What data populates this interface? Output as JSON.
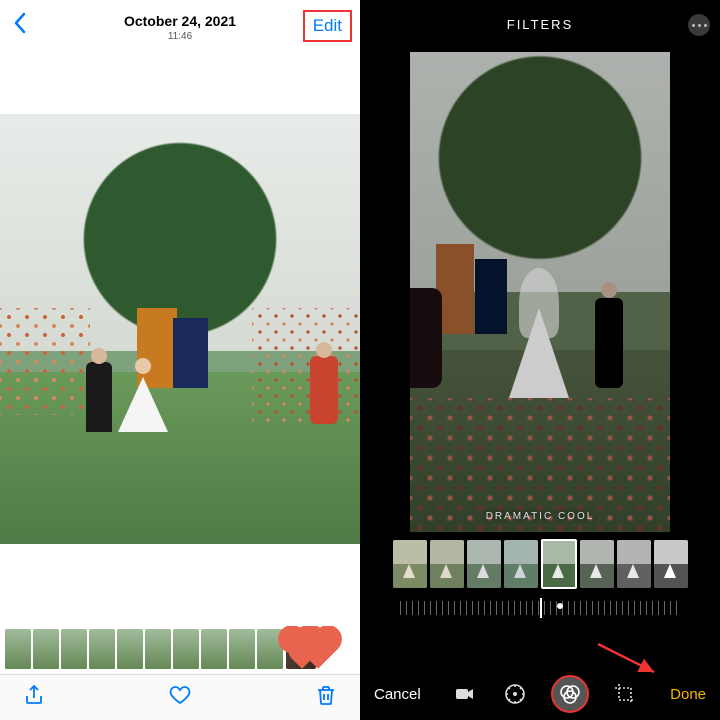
{
  "left": {
    "date": "October 24, 2021",
    "time": "11:46",
    "edit_label": "Edit"
  },
  "right": {
    "header_title": "FILTERS",
    "filter_name": "DRAMATIC COOL",
    "cancel_label": "Cancel",
    "done_label": "Done"
  }
}
